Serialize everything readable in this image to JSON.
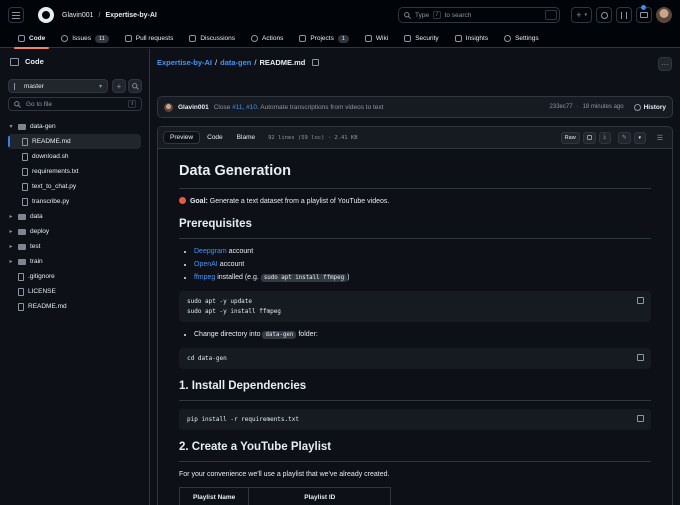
{
  "header": {
    "owner": "Glavin001",
    "separator": "/",
    "repo": "Expertise-by-AI",
    "search_placeholder_pre": "Type",
    "search_key": "/",
    "search_placeholder_post": "to search",
    "plus": "+"
  },
  "repo_nav": {
    "tabs": [
      {
        "label": "Code",
        "icon": "code-icon"
      },
      {
        "label": "Issues",
        "icon": "issue-icon",
        "count": "11"
      },
      {
        "label": "Pull requests",
        "icon": "pull-request-icon"
      },
      {
        "label": "Discussions",
        "icon": "discussions-icon"
      },
      {
        "label": "Actions",
        "icon": "actions-icon"
      },
      {
        "label": "Projects",
        "icon": "projects-icon",
        "count": "1"
      },
      {
        "label": "Wiki",
        "icon": "book-icon"
      },
      {
        "label": "Security",
        "icon": "shield-icon"
      },
      {
        "label": "Insights",
        "icon": "graph-icon"
      },
      {
        "label": "Settings",
        "icon": "gear-icon"
      }
    ]
  },
  "sidebar": {
    "title": "Code",
    "branch": "master",
    "goto_placeholder": "Go to file",
    "goto_key": "t",
    "tree": [
      {
        "name": "data-gen",
        "type": "folder",
        "open": true,
        "depth": 0
      },
      {
        "name": "README.md",
        "type": "file",
        "depth": 1,
        "selected": true
      },
      {
        "name": "download.sh",
        "type": "file",
        "depth": 1
      },
      {
        "name": "requirements.txt",
        "type": "file",
        "depth": 1
      },
      {
        "name": "text_to_chat.py",
        "type": "file",
        "depth": 1
      },
      {
        "name": "transcribe.py",
        "type": "file",
        "depth": 1
      },
      {
        "name": "data",
        "type": "folder",
        "depth": 0
      },
      {
        "name": "deploy",
        "type": "folder",
        "depth": 0
      },
      {
        "name": "test",
        "type": "folder",
        "depth": 0
      },
      {
        "name": "train",
        "type": "folder",
        "depth": 0
      },
      {
        "name": ".gitignore",
        "type": "file",
        "depth": 0
      },
      {
        "name": "LICENSE",
        "type": "file",
        "depth": 0
      },
      {
        "name": "README.md",
        "type": "file",
        "depth": 0
      }
    ]
  },
  "breadcrumb": {
    "repo": "Expertise-by-AI",
    "folder": "data-gen",
    "file": "README.md",
    "sep": "/"
  },
  "commit": {
    "author": "Glavin001",
    "msg_pre": "Close ",
    "ref1": "#11",
    "msg_mid": ", ",
    "ref2": "#10",
    "msg_post": ". Automate transcriptions from videos to text",
    "sha": "233ec77",
    "dot": "·",
    "time": "18 minutes ago",
    "history": "History"
  },
  "file_toolbar": {
    "tabs": [
      "Preview",
      "Code",
      "Blame"
    ],
    "meta": "92 lines (59 loc) · 2.41 KB",
    "raw": "Raw"
  },
  "readme": {
    "h1": "Data Generation",
    "goal_label": "Goal:",
    "goal_text": "Generate a text dataset from a playlist of YouTube videos.",
    "prereq_h": "Prerequisites",
    "prereq": [
      {
        "link": "Deepgram",
        "text": " account"
      },
      {
        "link": "OpenAI",
        "text": " account"
      },
      {
        "link": "ffmpeg",
        "text": " installed (e.g. ",
        "code": "sudo apt install ffmpeg",
        "tail": ")"
      }
    ],
    "code1": "sudo apt -y update\nsudo apt -y install ffmpeg",
    "step_pre": "Change directory into ",
    "step_code": "data-gen",
    "step_post": " folder:",
    "code2": "cd data-gen",
    "h_install": "1. Install Dependencies",
    "code3": "pip install -r requirements.txt",
    "h_playlist": "2. Create a YouTube Playlist",
    "playlist_text": "For your convenience we'll use a playlist that we've already created.",
    "table_headers": [
      "Playlist Name",
      "Playlist ID"
    ]
  },
  "colors": {
    "accent": "#4493f8",
    "nav_underline": "#f78166",
    "bg": "#0d1117"
  }
}
